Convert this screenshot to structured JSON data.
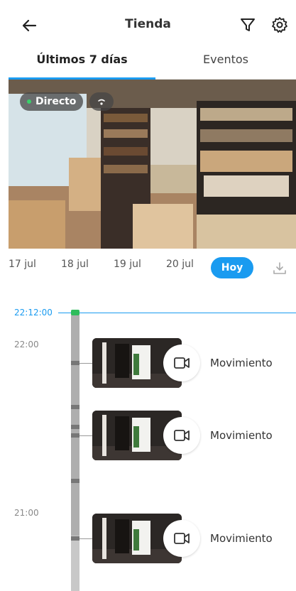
{
  "header": {
    "title": "Tienda",
    "back_icon": "arrow-left-icon",
    "filter_icon": "filter-icon",
    "settings_icon": "gear-icon"
  },
  "tabs": [
    {
      "label": "Últimos 7 días",
      "active": true
    },
    {
      "label": "Eventos",
      "active": false
    }
  ],
  "video": {
    "live_label": "Directo",
    "live_color": "#3ad06a",
    "connection_icon": "wifi-icon"
  },
  "dates": {
    "items": [
      "17 jul",
      "18 jul",
      "19 jul",
      "20 jul"
    ],
    "today": "Hoy",
    "download_icon": "download-icon"
  },
  "timeline": {
    "current_time": "22:12:00",
    "hour_labels": [
      "22:00",
      "21:00"
    ],
    "events": [
      {
        "label": "Movimiento",
        "icon": "video-camera-icon"
      },
      {
        "label": "Movimiento",
        "icon": "video-camera-icon"
      },
      {
        "label": "Movimiento",
        "icon": "video-camera-icon"
      }
    ]
  },
  "colors": {
    "accent": "#1a9bf0",
    "live": "#2ebc5b"
  }
}
